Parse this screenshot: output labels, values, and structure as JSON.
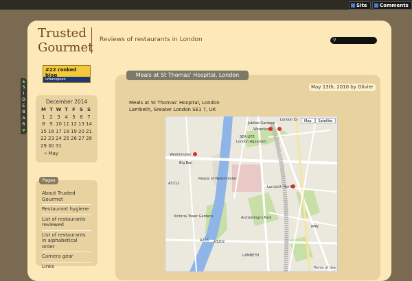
{
  "topbar": {
    "site_label": "Site",
    "comments_label": "Comments"
  },
  "header": {
    "title_line1": "Trusted",
    "title_line2": "Gourmet",
    "tagline": "Reviews of restaurants in London"
  },
  "sidebar_tab": {
    "letters": [
      "S",
      "I",
      "D",
      "E",
      "B",
      "A",
      "R"
    ]
  },
  "badge": {
    "rank_text": "#22 ranked blog",
    "brand": "urbanspoon"
  },
  "calendar": {
    "title": "December 2014",
    "weekdays": [
      "M",
      "T",
      "W",
      "T",
      "F",
      "S",
      "S"
    ],
    "weeks": [
      [
        "1",
        "2",
        "3",
        "4",
        "5",
        "6",
        "7"
      ],
      [
        "8",
        "9",
        "10",
        "11",
        "12",
        "13",
        "14"
      ],
      [
        "15",
        "16",
        "17",
        "18",
        "19",
        "20",
        "21"
      ],
      [
        "22",
        "23",
        "24",
        "25",
        "26",
        "27",
        "28"
      ],
      [
        "29",
        "30",
        "31",
        "",
        "",
        "",
        ""
      ]
    ],
    "prev_link": "« May"
  },
  "pages": {
    "heading": "Pages",
    "items": [
      "About Trusted Gourmet",
      "Restaurant hygiene",
      "List of restaurants reviewed",
      "List of restaurants in alphabetical order",
      "Camera gear",
      "Links"
    ]
  },
  "post": {
    "title": "Meals at St Thomas' Hospital, London",
    "date": "May 13th, 2010 by Olivier",
    "address_line1": "Meals at St Thomas' Hospital, London",
    "address_line2": "Lambeth, Greater London SE1 7, UK"
  },
  "map": {
    "btn_map": "Map",
    "btn_sat": "Satellite",
    "terms": "Terms of Use",
    "labels": {
      "jubilee": "Jubilee Gardens",
      "waterloo": "Waterloo",
      "london_eye": "London Ey",
      "sealife": "SEA LIFE",
      "aquarium": "London Aquarium",
      "westminster": "Westminster",
      "bigben": "Big Ben",
      "palace": "Palace of Westminster",
      "lambeth_north": "Lambeth North",
      "victoria": "Victoria Tower Gardens",
      "archbishop": "Archbishop's Park",
      "a3202": "A3202",
      "a203": "A203",
      "lambeth": "LAMBETH",
      "imw": "IMW",
      "a3212": "A3212"
    }
  }
}
